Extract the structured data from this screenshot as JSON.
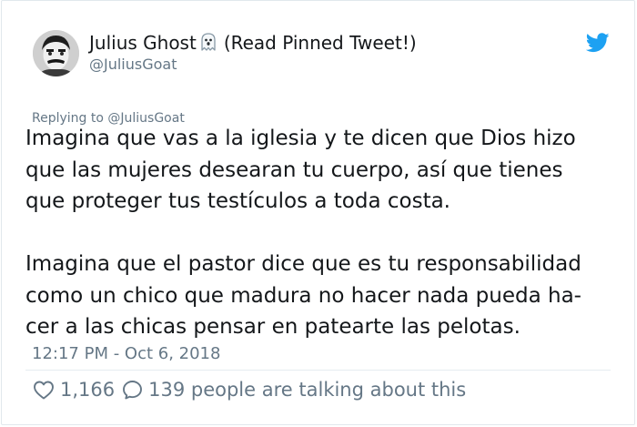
{
  "tweet": {
    "author": {
      "display_name": "Julius Ghost",
      "display_suffix": "(Read Pinned Tweet!)",
      "handle": "@JuliusGoat",
      "avatar_icon": "avatar-man-photo",
      "name_emoji": "ghost-icon"
    },
    "brand_icon": "twitter-bird-icon",
    "brand_color": "#1da1f2",
    "reply_context": "Replying to @JuliusGoat",
    "paragraphs": [
      "Imagina que vas a la iglesia y te dicen que Dios hizo\nque las mujeres desearan tu cuerpo, así que tienes\nque proteger tus testículos a toda costa.",
      "Imagina que el pastor dice que es tu responsabilidad\ncomo un chico que madura no hacer nada pueda ha-\ncer a las chicas pensar en patearte las pelotas."
    ],
    "timestamp": "12:17 PM - Oct 6, 2018",
    "likes": "1,166",
    "talking": "139 people are talking about this",
    "muted_color": "#657786"
  }
}
